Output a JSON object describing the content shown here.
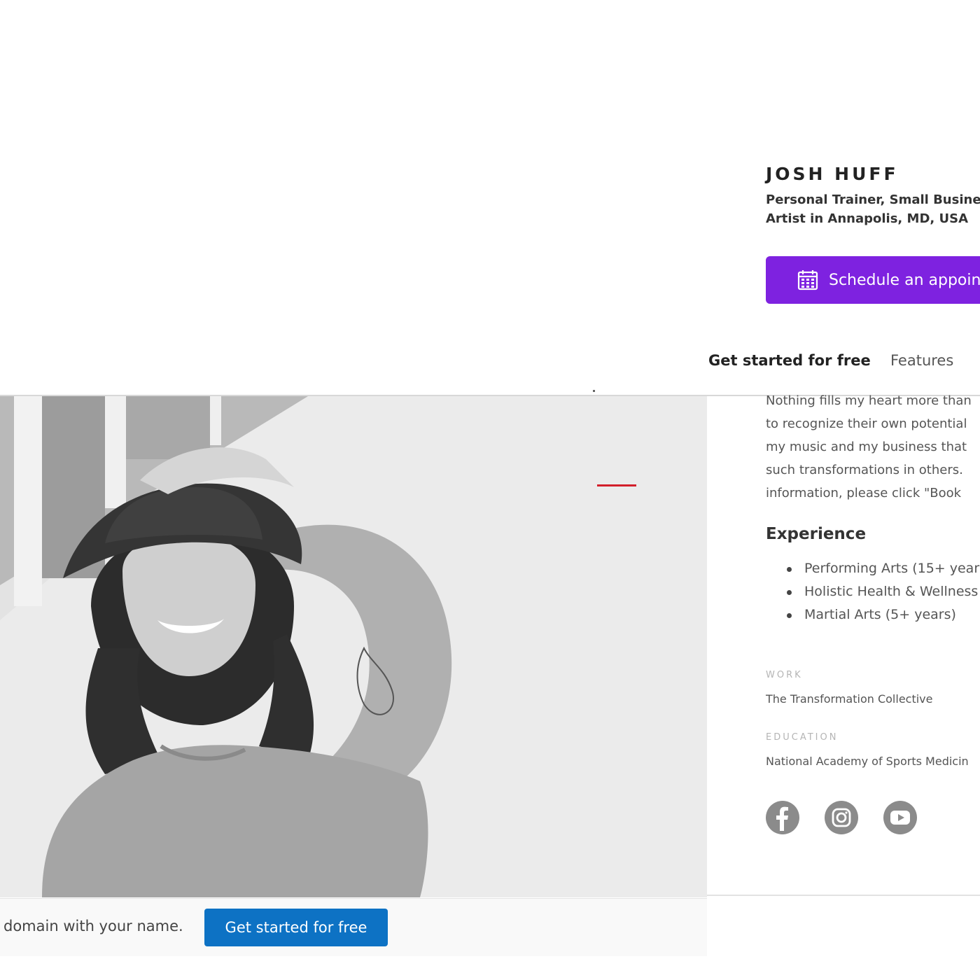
{
  "profile": {
    "name": "JOSH HUFF",
    "subtitle_line1": "Personal Trainer, Small Busine",
    "subtitle_line2": "Artist in Annapolis, MD, USA",
    "schedule_label": "Schedule an appoin"
  },
  "nav": {
    "primary": "Get started for free",
    "features": "Features"
  },
  "bio": {
    "lines": [
      "Nothing fills my heart more than",
      "to recognize their own potential",
      "my music and my business that",
      "such transformations in others.",
      "information, please click \"Book"
    ]
  },
  "experience": {
    "title": "Experience",
    "items": [
      "Performing Arts (15+ years",
      "Holistic Health & Wellness",
      "Martial Arts (5+ years)"
    ]
  },
  "work": {
    "label": "WORK",
    "value": "The Transformation Collective"
  },
  "education": {
    "label": "EDUCATION",
    "value": "National Academy of Sports Medicin"
  },
  "social": {
    "icons": [
      "facebook-icon",
      "instagram-icon",
      "youtube-icon"
    ]
  },
  "footer": {
    "domain_text": "domain with your name.",
    "cta_label": "Get started for free"
  },
  "colors": {
    "accent_purple": "#7e22e0",
    "cta_blue": "#0d72c4",
    "accent_red": "#d21f2b"
  }
}
